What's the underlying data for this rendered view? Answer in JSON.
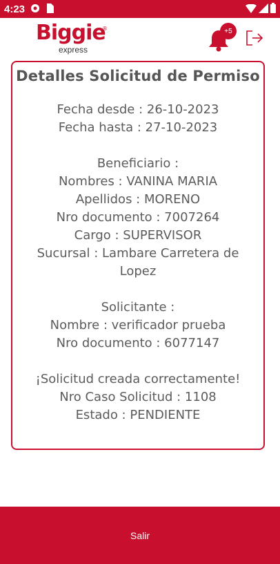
{
  "status_bar": {
    "time": "4:23"
  },
  "header": {
    "logo_text": "Biggie",
    "logo_sub": "express",
    "logo_reg": "®",
    "notification_badge": "+5"
  },
  "card": {
    "title": "Detalles Solicitud de Permiso",
    "fecha_desde": "Fecha desde : 26-10-2023",
    "fecha_hasta": "Fecha hasta : 27-10-2023",
    "beneficiario_label": "Beneficiario :",
    "nombres": "Nombres : VANINA MARIA",
    "apellidos": "Apellidos : MORENO",
    "nro_documento_benef": "Nro documento : 7007264",
    "cargo": "Cargo : SUPERVISOR",
    "sucursal_line1": "Sucursal : Lambare Carretera de",
    "sucursal_line2": "Lopez",
    "solicitante_label": "Solicitante :",
    "nombre_solicitante": "Nombre : verificador prueba",
    "nro_documento_solic": "Nro documento : 6077147",
    "success_msg": "¡Solicitud creada correctamente!",
    "nro_caso": "Nro Caso Solicitud : 1108",
    "estado": "Estado : PENDIENTE"
  },
  "footer": {
    "salir_label": "Salir"
  },
  "colors": {
    "brand": "#c8102e",
    "text": "#5b5b5b"
  }
}
